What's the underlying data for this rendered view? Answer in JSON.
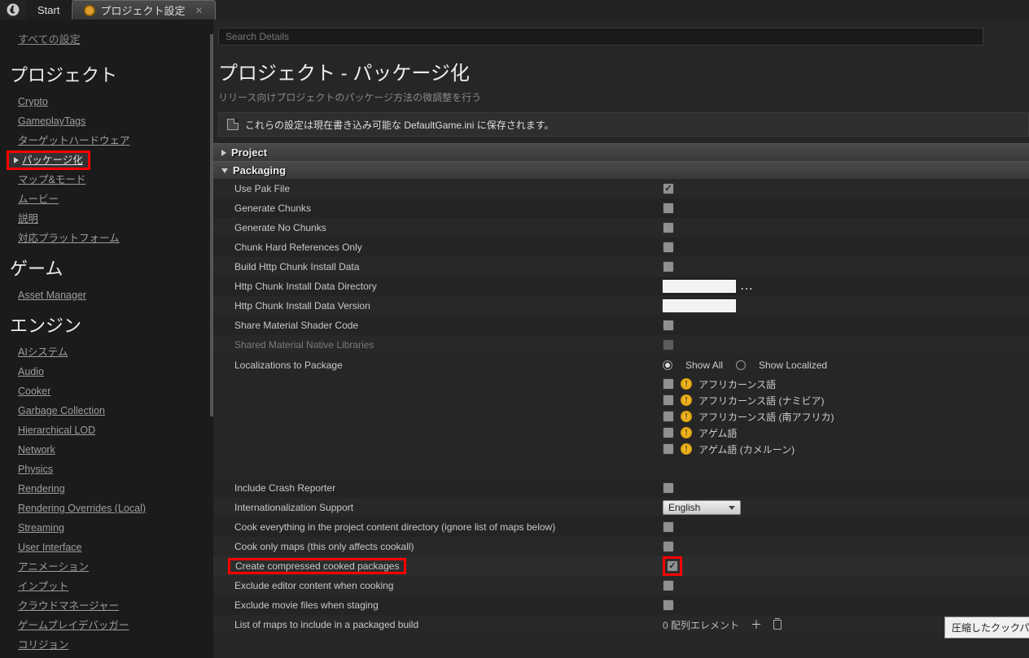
{
  "tabs": {
    "start": "Start",
    "settings": "プロジェクト設定"
  },
  "sidebar": {
    "all": "すべての設定",
    "cat_project": "プロジェクト",
    "project_items": [
      "Crypto",
      "GameplayTags",
      "ターゲットハードウェア",
      "パッケージ化",
      "マップ&モード",
      "ムービー",
      "説明",
      "対応プラットフォーム"
    ],
    "cat_game": "ゲーム",
    "game_items": [
      "Asset Manager"
    ],
    "cat_engine": "エンジン",
    "engine_items": [
      "AIシステム",
      "Audio",
      "Cooker",
      "Garbage Collection",
      "Hierarchical LOD",
      "Network",
      "Physics",
      "Rendering",
      "Rendering Overrides (Local)",
      "Streaming",
      "User Interface",
      "アニメーション",
      "インプット",
      "クラウドマネージャー",
      "ゲームプレイデバッガー",
      "コリジョン"
    ]
  },
  "content": {
    "search_placeholder": "Search Details",
    "title": "プロジェクト - パッケージ化",
    "subtitle": "リリース向けプロジェクトのパッケージ方法の微調整を行う",
    "info": "これらの設定は現在書き込み可能な DefaultGame.ini に保存されます。",
    "section_project": "Project",
    "section_packaging": "Packaging",
    "rows": {
      "use_pak": "Use Pak File",
      "gen_chunks": "Generate Chunks",
      "gen_no_chunks": "Generate No Chunks",
      "chunk_hard": "Chunk Hard References Only",
      "build_http": "Build Http Chunk Install Data",
      "http_dir": "Http Chunk Install Data Directory",
      "http_ver": "Http Chunk Install Data Version",
      "share_mat": "Share Material Shader Code",
      "shared_native": "Shared Material Native Libraries",
      "loc_to_pkg": "Localizations to Package",
      "show_all": "Show All",
      "show_loc": "Show Localized",
      "langs": [
        "アフリカーンス語",
        "アフリカーンス語 (ナミビア)",
        "アフリカーンス語 (南アフリカ)",
        "アゲム語",
        "アゲム語 (カメルーン)"
      ],
      "include_crash": "Include Crash Reporter",
      "intl_support": "Internationalization Support",
      "intl_value": "English",
      "cook_all": "Cook everything in the project content directory (ignore list of maps below)",
      "cook_only": "Cook only maps (this only affects cookall)",
      "create_compressed": "Create compressed cooked packages",
      "exclude_editor": "Exclude editor content when cooking",
      "exclude_movie": "Exclude movie files when staging",
      "list_maps": "List of maps to include in a packaged build",
      "array_count": "0 配列エレメント"
    },
    "tooltip": "圧縮したクックパッケージを作成（デプロイメントサイズを減少）"
  }
}
